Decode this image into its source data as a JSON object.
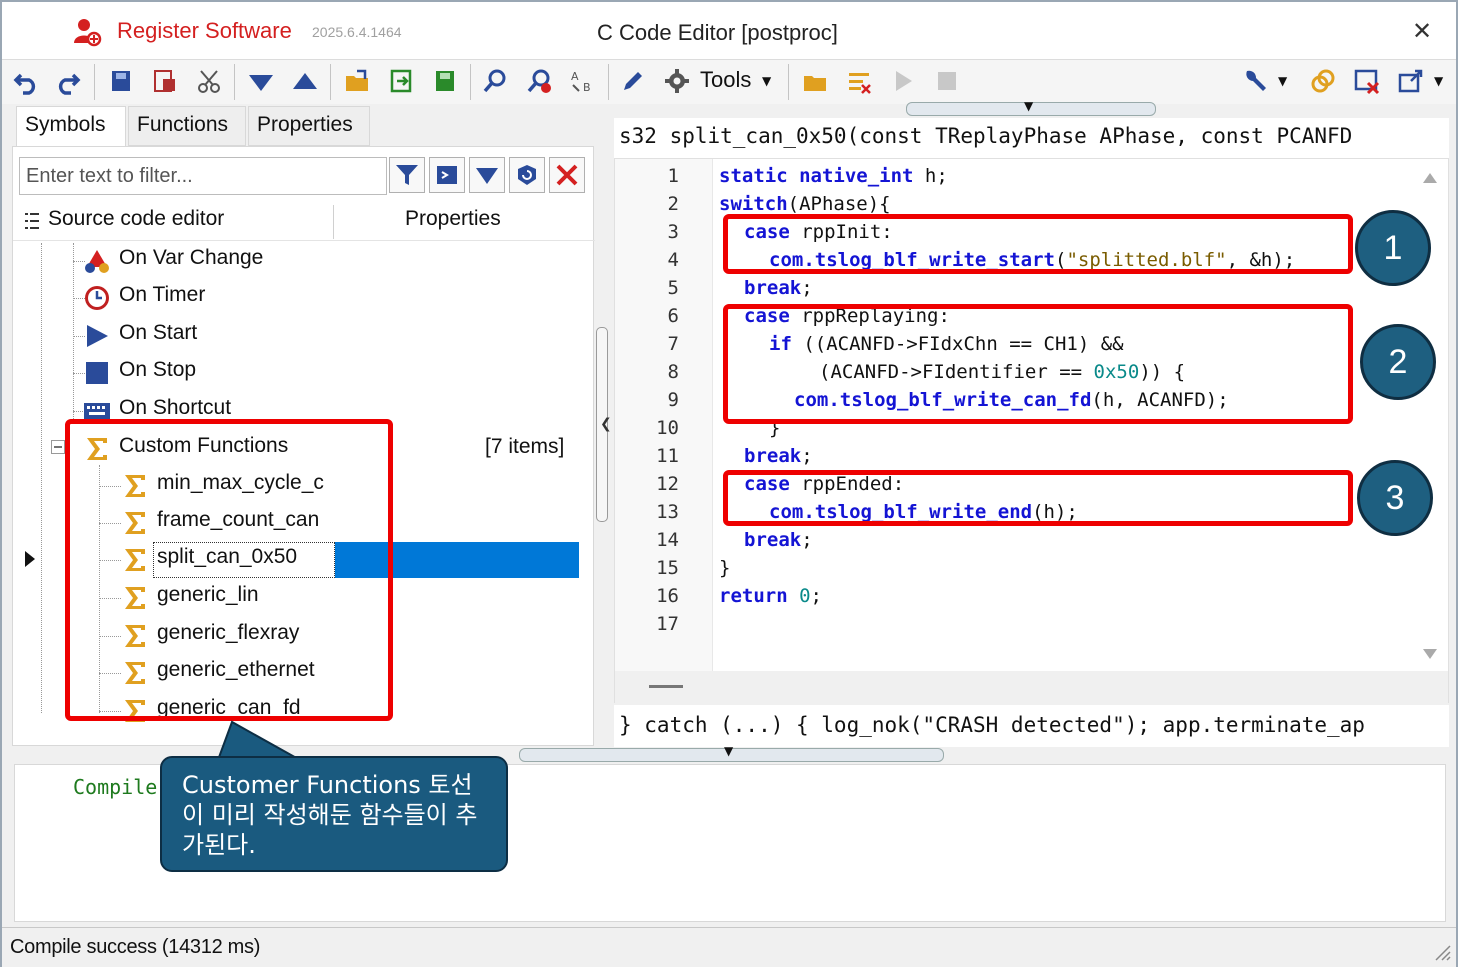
{
  "titlebar": {
    "brand": "Register Software",
    "version": "2025.6.4.1464",
    "title": "C Code Editor [postproc]",
    "close": "✕"
  },
  "toolbar": {
    "tools_label": "Tools",
    "icons": [
      "undo-icon",
      "redo-icon",
      "save-icon",
      "save-as-icon",
      "cut-icon",
      "move-down-icon",
      "move-up-icon",
      "open-folder-icon",
      "export-icon",
      "import-icon",
      "find-icon",
      "find-replace-icon",
      "replace-ab-icon",
      "edit-pen-icon",
      "gear-icon",
      "folder-icon",
      "checklist-icon",
      "run-icon",
      "stop-icon",
      "wrench-icon",
      "link-icon",
      "close-window-icon",
      "new-window-icon"
    ]
  },
  "tabs": [
    "Symbols",
    "Functions",
    "Properties"
  ],
  "filter": {
    "placeholder": "Enter text to filter..."
  },
  "columns": {
    "source": "Source code editor",
    "properties": "Properties"
  },
  "tree": {
    "events": [
      {
        "label": "On Var Change",
        "icon": "var-change-icon"
      },
      {
        "label": "On Timer",
        "icon": "timer-icon"
      },
      {
        "label": "On Start",
        "icon": "start-icon"
      },
      {
        "label": "On Stop",
        "icon": "stop-icon"
      },
      {
        "label": "On Shortcut",
        "icon": "keyboard-icon"
      }
    ],
    "custom_group": {
      "label": "Custom Functions",
      "count": "[7 items]"
    },
    "custom_items": [
      "min_max_cycle_c",
      "frame_count_can",
      "split_can_0x50",
      "generic_lin",
      "generic_flexray",
      "generic_ethernet",
      "generic_can_fd"
    ],
    "selected_index": 2
  },
  "editor": {
    "signature": "s32 split_can_0x50(const TReplayPhase APhase, const PCANFD",
    "line_numbers": [
      "1",
      "2",
      "3",
      "4",
      "5",
      "6",
      "7",
      "8",
      "9",
      "10",
      "11",
      "12",
      "13",
      "14",
      "15",
      "16",
      "17"
    ],
    "lines": {
      "l1_kw1": "static",
      "l1_kw2": "native_int",
      "l1_rest": " h;",
      "l2_kw": "switch",
      "l2_rest": "(APhase){",
      "l3_kw": "case",
      "l3_rest": " rppInit:",
      "l4_fn": "com.tslog_blf_write_start",
      "l4_open": "(",
      "l4_str": "\"splitted.blf\"",
      "l4_rest": ", &h);",
      "l5_kw": "break",
      "l5_rest": ";",
      "l6_kw": "case",
      "l6_rest": " rppReplaying:",
      "l7_kw": "if",
      "l7_rest": " ((ACANFD->FIdxChn == CH1) &&",
      "l8_pre": "(ACANFD->FIdentifier == ",
      "l8_num": "0x50",
      "l8_rest": ")) {",
      "l9_fn": "com.tslog_blf_write_can_fd",
      "l9_rest": "(h, ACANFD);",
      "l10": "}",
      "l11_kw": "break",
      "l11_rest": ";",
      "l12_kw": "case",
      "l12_rest": " rppEnded:",
      "l13_fn": "com.tslog_blf_write_end",
      "l13_rest": "(h);",
      "l14_kw": "break",
      "l14_rest": ";",
      "l15": "}",
      "l16_kw": "return",
      "l16_sp": " ",
      "l16_num": "0",
      "l16_rest": ";"
    },
    "catch_line": "} catch (...) { log_nok(\"CRASH detected\"); app.terminate_ap"
  },
  "output": {
    "text": "Compile"
  },
  "status": {
    "text": "Compile success (14312 ms)"
  },
  "annotations": {
    "circles": [
      "1",
      "2",
      "3"
    ],
    "callout": "Customer Functions 토선이 미리 작성해둔 함수들이 추가된다."
  },
  "colors": {
    "brand": "#d42020",
    "keyword": "#1414d4",
    "string": "#7a5c00",
    "number": "#0a8a8a",
    "selection": "#0078d7",
    "annotation_red": "#ee0000",
    "callout": "#1a5a7f"
  }
}
